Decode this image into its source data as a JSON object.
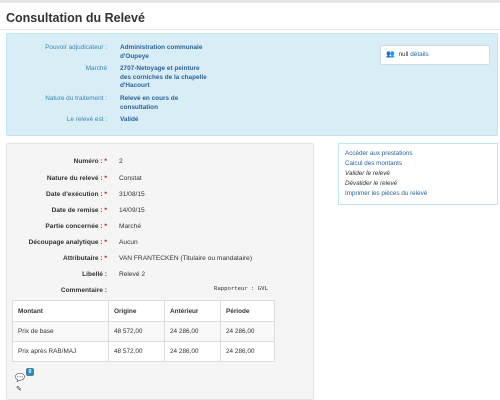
{
  "page": {
    "title": "Consultation du Relevé"
  },
  "info": {
    "rows": [
      {
        "label": "Pouvoir adjudicateur :",
        "value": "Administration communale\nd'Oupeye"
      },
      {
        "label": "Marché",
        "value": "2707-Netoyage et peinture\ndes corniches de la chapelle\nd'Hacourt"
      },
      {
        "label": "Nature du traitement :",
        "value": "Relevé en cours de\nconsultation"
      },
      {
        "label": "Le relevé est :",
        "value": "Validé"
      }
    ],
    "users_box": {
      "icon": "users-icon",
      "text": "null",
      "link": "détails"
    }
  },
  "details": {
    "fields": [
      {
        "label": "Numéro :",
        "value": "2",
        "required": true
      },
      {
        "label": "Nature du relevé :",
        "value": "Constat",
        "required": true
      },
      {
        "label": "Date d'exécution :",
        "value": "31/08/15",
        "required": true
      },
      {
        "label": "Date de remise :",
        "value": "14/09/15",
        "required": true
      },
      {
        "label": "Partie concernée :",
        "value": "Marché",
        "required": true
      },
      {
        "label": "Découpage analytique :",
        "value": "Aucun",
        "required": true
      },
      {
        "label": "Attributaire :",
        "value": "VAN FRANTECKEN (Titulaire ou mandataire)",
        "required": true
      },
      {
        "label": "Libellé :",
        "value": "Relevé 2",
        "required": false
      },
      {
        "label": "Commentaire :",
        "value": "",
        "required": false
      }
    ],
    "rapporteur": "Rapporteur : GVL",
    "table": {
      "headers": [
        "Montant",
        "Origine",
        "Antérieur",
        "Période"
      ],
      "rows": [
        [
          "Prix de base",
          "48 572,00",
          "24 286,00",
          "24 286,00"
        ],
        [
          "Prix après RAB/MAJ",
          "48 572,00",
          "24 286,00",
          "24 286,00"
        ]
      ]
    },
    "comment_count": "0",
    "icons": {
      "comment": "comment-icon",
      "edit": "pencil-icon"
    }
  },
  "actions": [
    {
      "label": "Accéder aux prestations",
      "enabled": true
    },
    {
      "label": "Calcul des montants",
      "enabled": true
    },
    {
      "label": "Valider le relevé",
      "enabled": false
    },
    {
      "label": "Dévalider le relevé",
      "enabled": false
    },
    {
      "label": "Imprimer les pièces du relevé",
      "enabled": true
    }
  ],
  "colors": {
    "info_bg": "#d9edf7",
    "info_label": "#3a87ad",
    "link": "#2a6496",
    "required": "#cc0000"
  }
}
